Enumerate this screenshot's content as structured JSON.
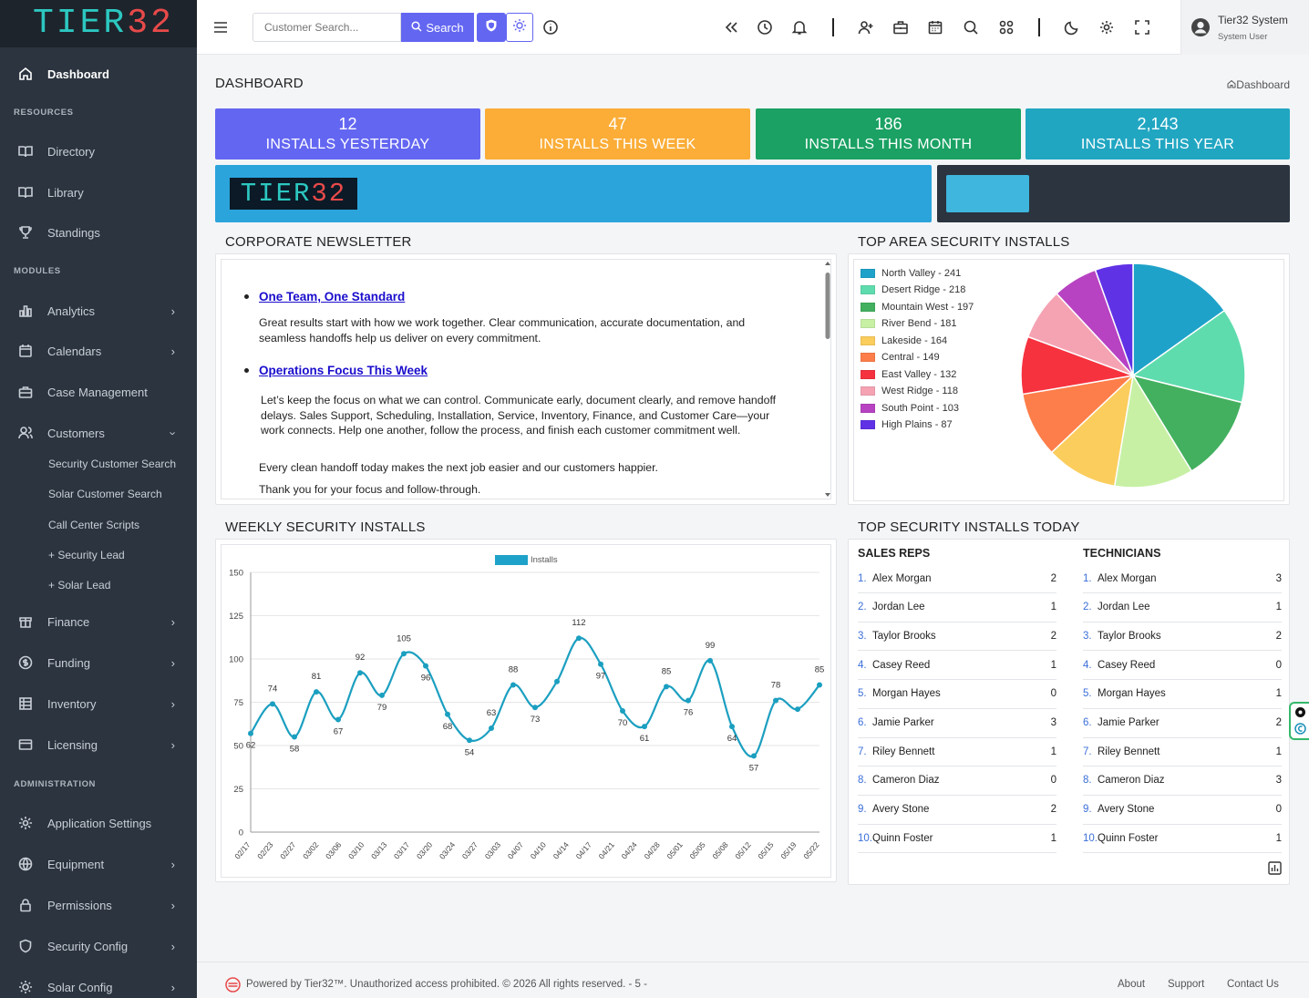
{
  "brand": {
    "logo_tier": "TIER",
    "logo_num": "32"
  },
  "sidebar": {
    "dashboard": "Dashboard",
    "sections": {
      "resources": "RESOURCES",
      "modules": "MODULES",
      "administration": "ADMINISTRATION"
    },
    "resources": [
      {
        "label": "Directory",
        "icon": "book-icon"
      },
      {
        "label": "Library",
        "icon": "book-icon"
      },
      {
        "label": "Standings",
        "icon": "trophy-icon"
      }
    ],
    "modules": [
      {
        "label": "Analytics",
        "icon": "bar-chart-icon"
      },
      {
        "label": "Calendars",
        "icon": "calendar-icon"
      },
      {
        "label": "Case Management",
        "icon": "briefcase-icon"
      },
      {
        "label": "Customers",
        "icon": "users-icon"
      }
    ],
    "customers_sub": [
      "Security Customer Search",
      "Solar Customer Search",
      "Call Center Scripts",
      "+ Security Lead",
      "+ Solar Lead"
    ],
    "modules2": [
      {
        "label": "Finance",
        "icon": "piggy-bank-icon"
      },
      {
        "label": "Funding",
        "icon": "dollar-circle-icon"
      },
      {
        "label": "Inventory",
        "icon": "inventory-icon"
      },
      {
        "label": "Licensing",
        "icon": "card-icon"
      }
    ],
    "admin": [
      {
        "label": "Application Settings",
        "icon": "gear-icon"
      },
      {
        "label": "Equipment",
        "icon": "globe-icon"
      },
      {
        "label": "Permissions",
        "icon": "lock-icon"
      },
      {
        "label": "Security Config",
        "icon": "shield-icon"
      },
      {
        "label": "Solar Config",
        "icon": "sun-icon"
      }
    ]
  },
  "topbar": {
    "search_placeholder": "Customer Search...",
    "search_label": "Search",
    "user_name": "Tier32 System",
    "user_role": "System User"
  },
  "page": {
    "title": "DASHBOARD",
    "breadcrumb": "Dashboard"
  },
  "stats": [
    {
      "value": "12",
      "label": "INSTALLS YESTERDAY",
      "color": "#6366f1"
    },
    {
      "value": "47",
      "label": "INSTALLS THIS WEEK",
      "color": "#fbad37"
    },
    {
      "value": "186",
      "label": "INSTALLS THIS MONTH",
      "color": "#1aa163"
    },
    {
      "value": "2,143",
      "label": "INSTALLS THIS YEAR",
      "color": "#21a6c2"
    }
  ],
  "newsletter": {
    "title": "CORPORATE NEWSLETTER",
    "items": [
      {
        "heading": "One Team, One Standard",
        "body": "Great results start with how we work together. Clear communication, accurate documentation, and seamless handoffs help us deliver on every commitment."
      },
      {
        "heading": "Operations Focus This Week",
        "body": "Let’s keep the focus on what we can control. Communicate early, document clearly, and remove handoff delays. Sales Support, Scheduling, Installation, Service, Inventory, Finance, and Customer Care—your work connects. Help one another, follow the process, and finish each customer commitment well."
      }
    ],
    "para2": "Every clean handoff today makes the next job easier and our customers happier.",
    "para3": "Thank you for your focus and follow-through."
  },
  "area": {
    "title": "TOP AREA SECURITY INSTALLS"
  },
  "weekly": {
    "title": "WEEKLY SECURITY INSTALLS"
  },
  "today": {
    "title": "TOP SECURITY INSTALLS TODAY",
    "reps_head": "SALES REPS",
    "tech_head": "TECHNICIANS",
    "reps": [
      {
        "i": "1.",
        "n": "Alex Morgan",
        "c": "2"
      },
      {
        "i": "2.",
        "n": "Jordan Lee",
        "c": "1"
      },
      {
        "i": "3.",
        "n": "Taylor Brooks",
        "c": "2"
      },
      {
        "i": "4.",
        "n": "Casey Reed",
        "c": "1"
      },
      {
        "i": "5.",
        "n": "Morgan Hayes",
        "c": "0"
      },
      {
        "i": "6.",
        "n": "Jamie Parker",
        "c": "3"
      },
      {
        "i": "7.",
        "n": "Riley Bennett",
        "c": "1"
      },
      {
        "i": "8.",
        "n": "Cameron Diaz",
        "c": "0"
      },
      {
        "i": "9.",
        "n": "Avery Stone",
        "c": "2"
      },
      {
        "i": "10.",
        "n": "Quinn Foster",
        "c": "1"
      }
    ],
    "techs": [
      {
        "i": "1.",
        "n": "Alex Morgan",
        "c": "3"
      },
      {
        "i": "2.",
        "n": "Jordan Lee",
        "c": "1"
      },
      {
        "i": "3.",
        "n": "Taylor Brooks",
        "c": "2"
      },
      {
        "i": "4.",
        "n": "Casey Reed",
        "c": "0"
      },
      {
        "i": "5.",
        "n": "Morgan Hayes",
        "c": "1"
      },
      {
        "i": "6.",
        "n": "Jamie Parker",
        "c": "2"
      },
      {
        "i": "7.",
        "n": "Riley Bennett",
        "c": "1"
      },
      {
        "i": "8.",
        "n": "Cameron Diaz",
        "c": "3"
      },
      {
        "i": "9.",
        "n": "Avery Stone",
        "c": "0"
      },
      {
        "i": "10.",
        "n": "Quinn Foster",
        "c": "1"
      }
    ]
  },
  "footer": {
    "text": "Powered by Tier32™. Unauthorized access prohibited. © 2026 All rights reserved. - 5 -",
    "about": "About",
    "support": "Support",
    "contact": "Contact Us"
  },
  "chart_data": [
    {
      "type": "pie",
      "legend_position": "left",
      "labels": [
        "North Valley - 241",
        "Desert Ridge - 218",
        "Mountain West - 197",
        "River Bend - 181",
        "Lakeside - 164",
        "Central - 149",
        "East Valley - 132",
        "West Ridge - 118",
        "South Point - 103",
        "High Plains - 87"
      ],
      "values": [
        241,
        218,
        197,
        181,
        164,
        149,
        132,
        118,
        103,
        87
      ],
      "colors": [
        "#1fa2c9",
        "#5fdcae",
        "#43b05f",
        "#c7f0a5",
        "#fbcd5d",
        "#fd7e4a",
        "#f6323f",
        "#f5a3b3",
        "#b743c2",
        "#6032e6"
      ]
    },
    {
      "type": "line",
      "legend": [
        "Installs"
      ],
      "color": "#1b9fc0",
      "x": [
        "02/17",
        "02/23",
        "02/27",
        "03/02",
        "03/06",
        "03/10",
        "03/13",
        "03/17",
        "03/20",
        "03/24",
        "03/27",
        "03/03",
        "04/07",
        "04/10",
        "04/14",
        "04/17",
        "04/21",
        "04/24",
        "04/28",
        "05/01",
        "05/05",
        "05/08",
        "05/12",
        "05/15",
        "05/19",
        "05/22"
      ],
      "series": [
        {
          "name": "Installs",
          "values": [
            57,
            74,
            55,
            81,
            65,
            92,
            79,
            103,
            96,
            68,
            53,
            60,
            85,
            72,
            87,
            112,
            97,
            70,
            61,
            84,
            76,
            99,
            61,
            44,
            76,
            71,
            85
          ]
        }
      ],
      "point_labels": [
        "62",
        "74",
        "58",
        "81",
        "67",
        "92",
        "79",
        "105",
        "96",
        "68",
        "54",
        "63",
        "88",
        "73",
        "",
        "112",
        "97",
        "70",
        "61",
        "85",
        "76",
        "99",
        "64",
        "57",
        "78",
        "",
        "85"
      ],
      "ylim": [
        0,
        150
      ],
      "yticks": [
        0,
        25,
        50,
        75,
        100,
        125,
        150
      ],
      "grid": "horizontal"
    }
  ]
}
